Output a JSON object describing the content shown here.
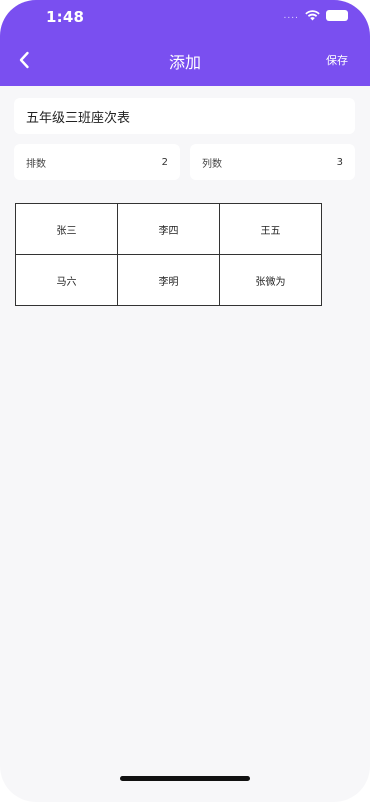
{
  "status_bar": {
    "time": "1:48",
    "dots": "...."
  },
  "nav": {
    "title": "添加",
    "save_label": "保存",
    "back_icon": "chevron-left-icon"
  },
  "form": {
    "seating_name": "五年级三班座次表",
    "rows_label": "排数",
    "rows_value": "2",
    "cols_label": "列数",
    "cols_value": "3"
  },
  "seating": {
    "rows": [
      [
        "张三",
        "李四",
        "王五"
      ],
      [
        "马六",
        "李明",
        "张微为"
      ]
    ]
  },
  "colors": {
    "accent": "#7a4ff0",
    "background": "#f7f7f9",
    "card": "#ffffff"
  }
}
